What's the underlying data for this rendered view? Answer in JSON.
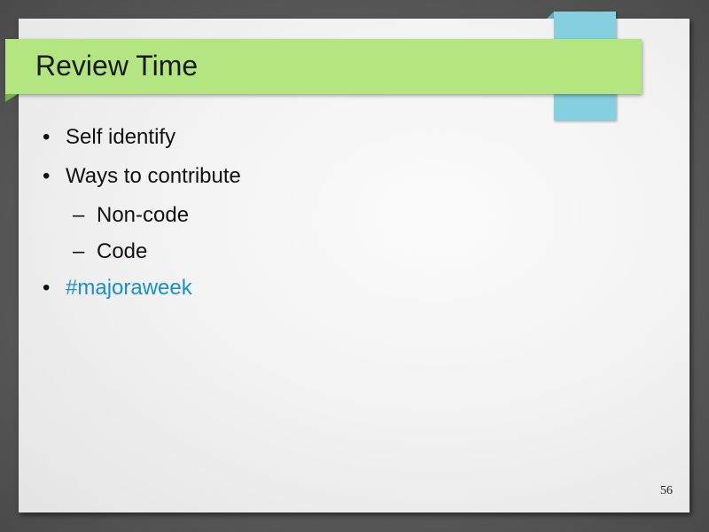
{
  "slide": {
    "title": "Review Time",
    "bullets": [
      {
        "marker": "•",
        "text": "Self identify"
      },
      {
        "marker": "•",
        "text": "Ways to contribute"
      },
      {
        "marker": "–",
        "text": "Non-code"
      },
      {
        "marker": "–",
        "text": "Code"
      },
      {
        "marker": "•",
        "text": "#majoraweek"
      }
    ],
    "page_number": "56"
  },
  "colors": {
    "title_band": "#b3e580",
    "tab_tape": "#84d0df",
    "link": "#1a8fd0"
  }
}
